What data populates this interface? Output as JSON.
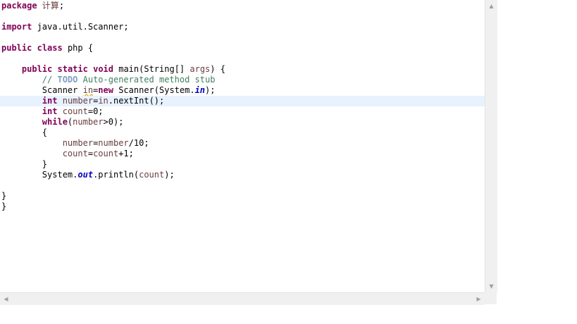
{
  "editor": {
    "lines": [
      {
        "kind": "package",
        "kw": "package",
        "name": " 计算",
        "end": ";"
      },
      {
        "kind": "blank"
      },
      {
        "kind": "import",
        "kw": "import",
        "rest": " java.util.Scanner;"
      },
      {
        "kind": "blank"
      },
      {
        "kind": "class",
        "kw1": "public",
        "kw2": "class",
        "rest": " php {"
      },
      {
        "kind": "blank"
      },
      {
        "kind": "method",
        "indent": "    ",
        "kw1": "public",
        "kw2": "static",
        "kw3": "void",
        "rest": " main(String[] ",
        "param": "args",
        "end": ") {"
      },
      {
        "kind": "comment",
        "indent": "        ",
        "c1": "// ",
        "todo": "TODO",
        "c2": " Auto-generated method stub"
      },
      {
        "kind": "scanner",
        "indent": "        ",
        "t1": "Scanner ",
        "v1": "in",
        "t2": "=",
        "kw": "new",
        "t3": " Scanner(System.",
        "fld": "in",
        "t4": ");"
      },
      {
        "kind": "number",
        "indent": "        ",
        "kw": "int",
        "t1": " ",
        "v1": "number",
        "t2": "=",
        "v2": "in",
        "t3": ".nextInt();"
      },
      {
        "kind": "count",
        "indent": "        ",
        "kw": "int",
        "t1": " ",
        "v1": "count",
        "t2": "=0;"
      },
      {
        "kind": "while",
        "indent": "        ",
        "kw": "while",
        "t1": "(",
        "v1": "number",
        "t2": ">0);"
      },
      {
        "kind": "plain",
        "indent": "        ",
        "text": "{"
      },
      {
        "kind": "assign",
        "indent": "            ",
        "v1": "number",
        "t1": "=",
        "v2": "number",
        "t2": "/10;"
      },
      {
        "kind": "assign",
        "indent": "            ",
        "v1": "count",
        "t1": "=",
        "v2": "count",
        "t2": "+1;"
      },
      {
        "kind": "plain",
        "indent": "        ",
        "text": "}"
      },
      {
        "kind": "print",
        "indent": "        ",
        "t1": "System.",
        "fld": "out",
        "t2": ".println(",
        "v1": "count",
        "t3": ");"
      },
      {
        "kind": "blank"
      },
      {
        "kind": "plain",
        "indent": "",
        "text": "}"
      },
      {
        "kind": "plain",
        "indent": "",
        "text": "}"
      }
    ],
    "current_line": 10
  },
  "scrollbars": {
    "up_arrow": "▲",
    "down_arrow": "▼",
    "left_arrow": "◀",
    "right_arrow": "▶"
  },
  "colors": {
    "keyword": "#7f0055",
    "comment": "#3f7f5f",
    "field": "#0000c0",
    "variable": "#6a3e3e",
    "current_line": "#e8f2fe"
  }
}
